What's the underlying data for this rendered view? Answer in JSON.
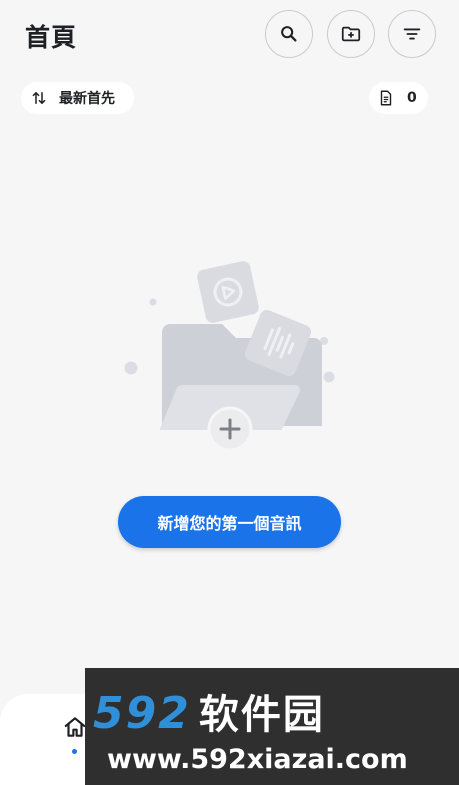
{
  "header": {
    "title": "首頁",
    "search_icon": "search-icon",
    "new_folder_icon": "create-folder-icon",
    "filter_icon": "filter-icon"
  },
  "sort_chip": {
    "label": "最新首先",
    "icon": "sort-arrows-icon"
  },
  "count_chip": {
    "count": "0",
    "icon": "document-icon"
  },
  "empty_state": {
    "button_label": "新增您的第一個音訊",
    "illustration": "folder-with-audio-files-icon"
  },
  "bottom_nav": {
    "home_icon": "home-icon",
    "active": "home"
  },
  "watermark": {
    "line1_number": "592",
    "line1_text": "软件园",
    "line2": "www.592xiazai.com"
  },
  "colors": {
    "background": "#f6f6f7",
    "accent": "#1a73e8",
    "watermark_blue": "#2f8fd8",
    "watermark_bg": "#2f2f2f"
  }
}
